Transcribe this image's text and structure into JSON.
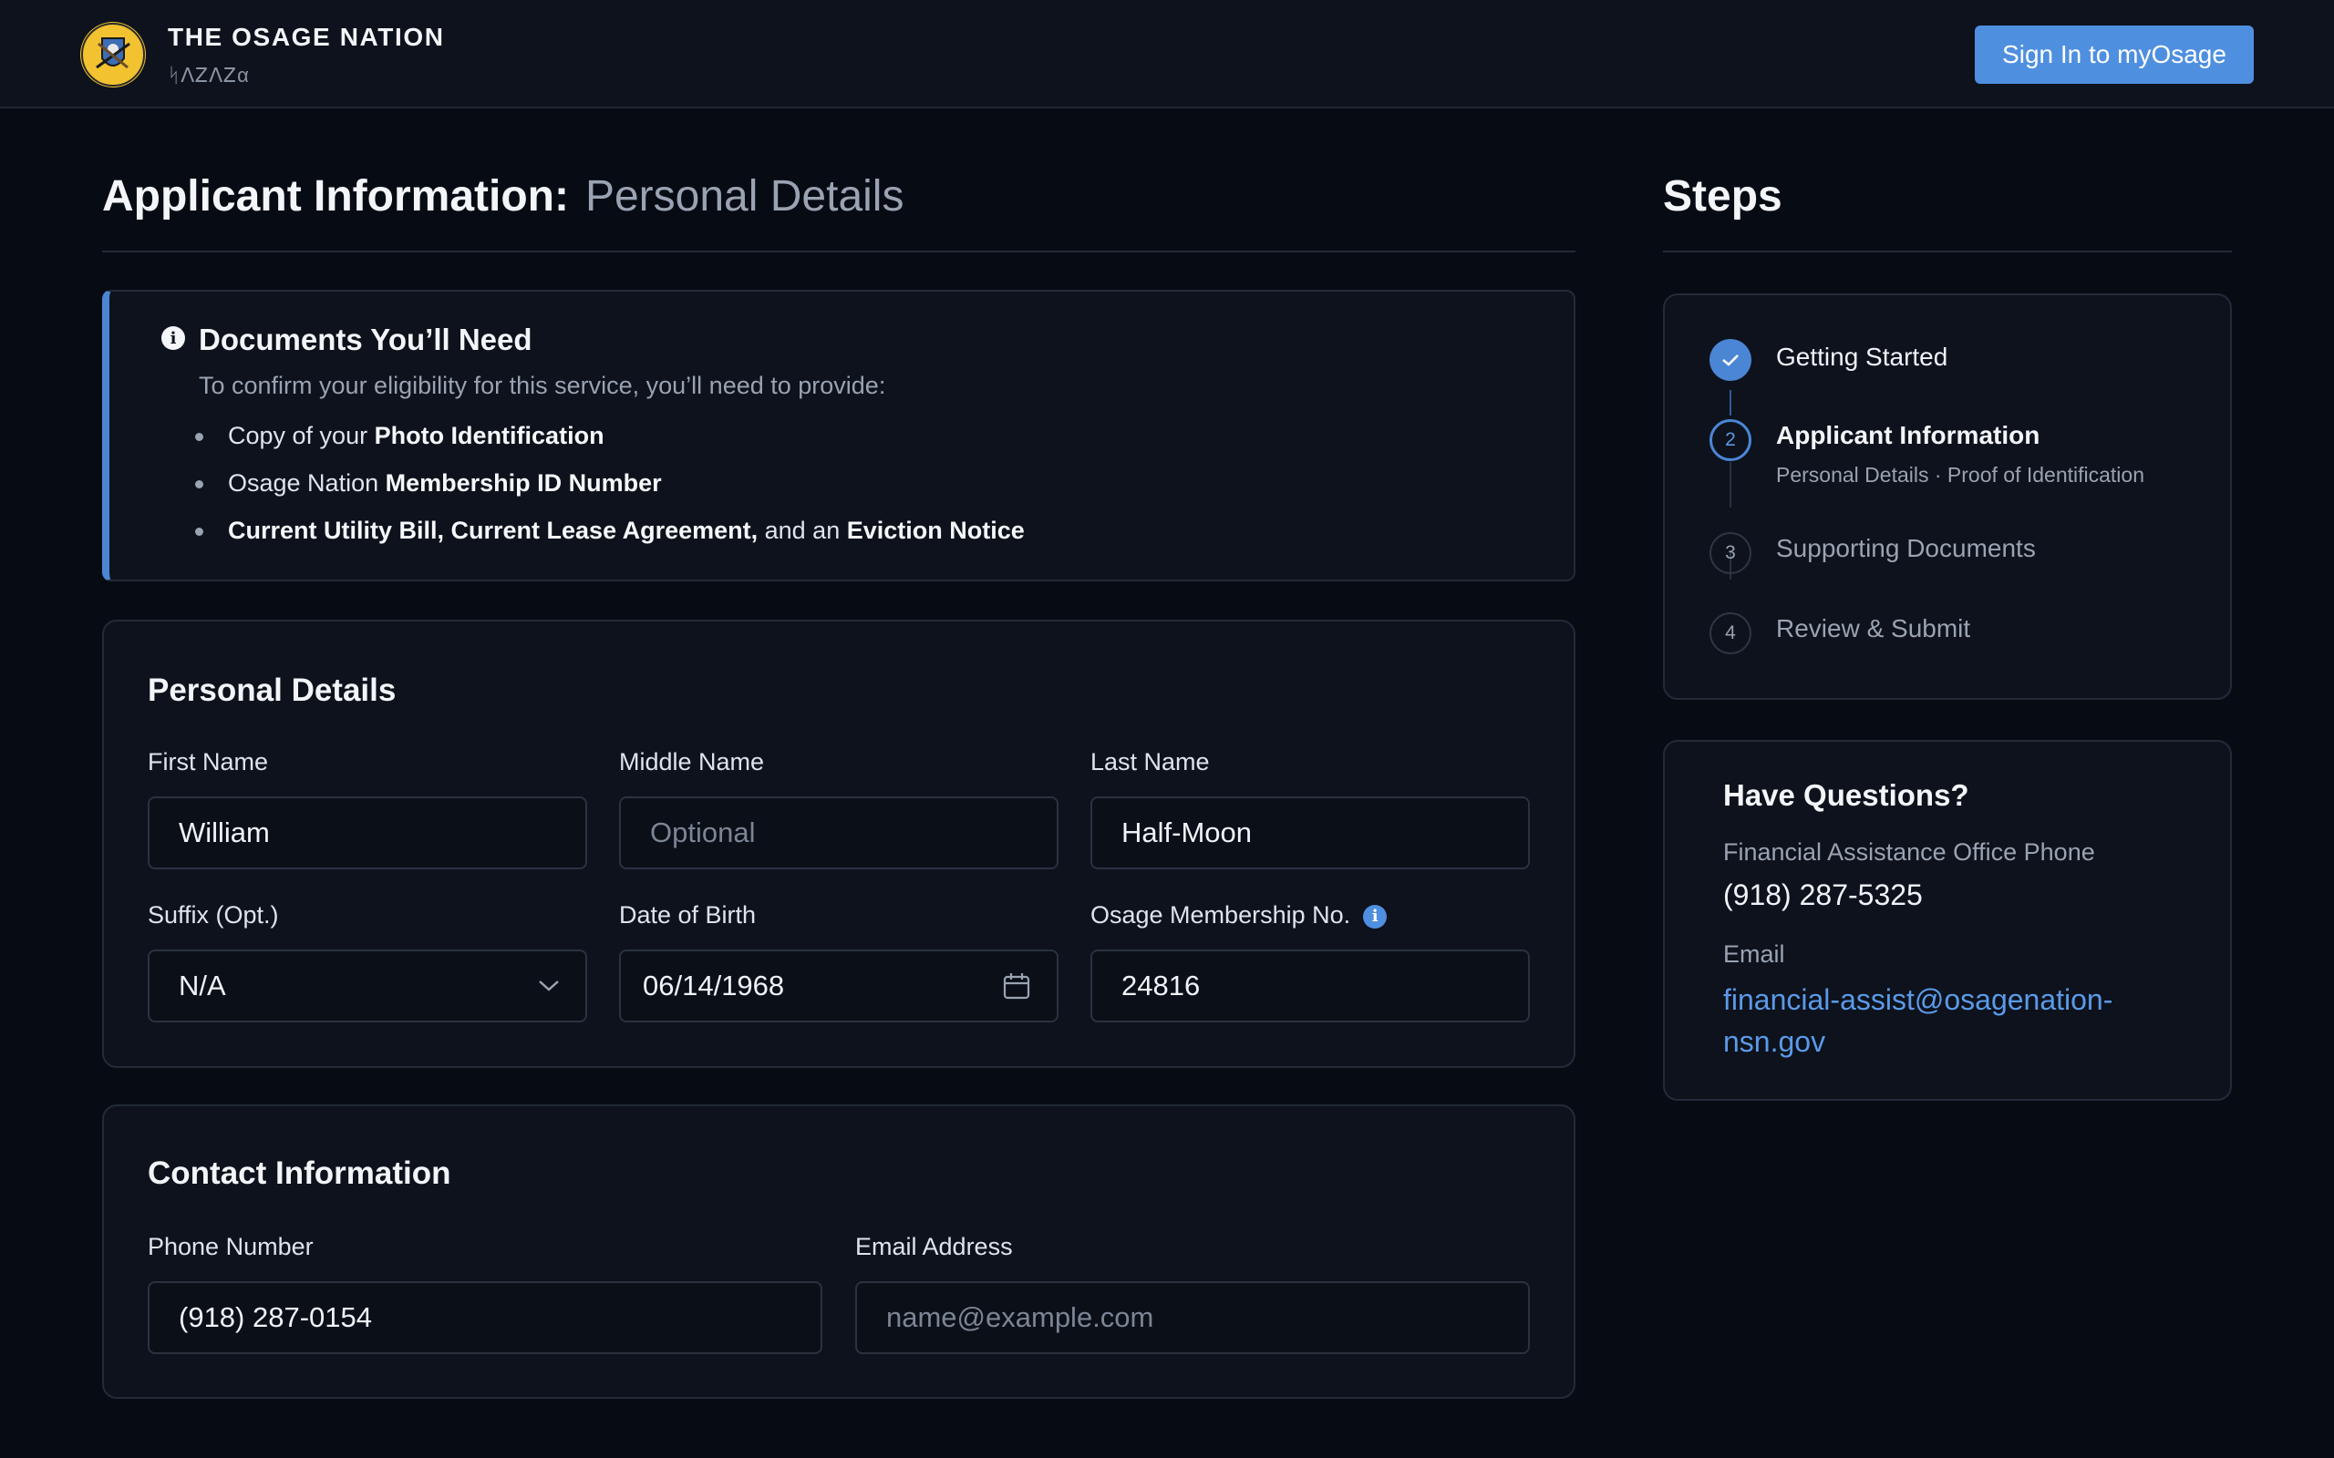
{
  "header": {
    "org_name": "THE OSAGE NATION",
    "org_name_native": "ᛋᐱᏃᐱᏃα",
    "signin_label": "Sign In to myOsage"
  },
  "page": {
    "title": "Applicant Information:",
    "subtitle": "Personal Details"
  },
  "documents": {
    "title": "Documents You’ll Need",
    "description": "To confirm your eligibility for this service, you’ll need to provide:",
    "items": [
      {
        "prefix": "Copy of your ",
        "bold": "Photo Identification",
        "suffix": ""
      },
      {
        "prefix": "Osage Nation ",
        "bold": "Membership ID Number",
        "suffix": ""
      },
      {
        "prefix": "",
        "bold": "Current Utility Bill, Current Lease Agreement,",
        "middle": " and an ",
        "bold2": "Eviction Notice"
      }
    ]
  },
  "personal": {
    "title": "Personal Details",
    "first_name": {
      "label": "First Name",
      "value": "William"
    },
    "middle_name": {
      "label": "Middle Name",
      "placeholder": "Optional"
    },
    "last_name": {
      "label": "Last Name",
      "value": "Half-Moon"
    },
    "suffix": {
      "label": "Suffix (Opt.)",
      "value": "N/A"
    },
    "dob": {
      "label": "Date of Birth",
      "value": "06/14/1968"
    },
    "membership": {
      "label": "Osage Membership No.",
      "value": "24816"
    }
  },
  "contact": {
    "title": "Contact Information",
    "phone": {
      "label": "Phone Number",
      "value": "(918) 287-0154"
    },
    "email": {
      "label": "Email Address",
      "placeholder": "name@example.com"
    }
  },
  "steps": {
    "title": "Steps",
    "items": [
      {
        "label": "Getting Started",
        "status": "complete"
      },
      {
        "number": "2",
        "label": "Applicant Information",
        "sub": "Personal Details · Proof of Identification",
        "status": "current"
      },
      {
        "number": "3",
        "label": "Supporting Documents",
        "status": "upcoming"
      },
      {
        "number": "4",
        "label": "Review & Submit",
        "status": "upcoming"
      }
    ]
  },
  "questions": {
    "title": "Have Questions?",
    "phone_label": "Financial Assistance Office Phone",
    "phone": "(918) 287-5325",
    "email_label": "Email",
    "email": "financial-assist@osagenation-nsn.gov"
  },
  "colors": {
    "accent": "#4f8fe0",
    "background": "#070b14",
    "card": "#0d121c",
    "seal": "#f2c230"
  },
  "icons": [
    "osage-seal-logo",
    "info-icon",
    "chevron-down-icon",
    "calendar-icon",
    "help-icon",
    "check-icon"
  ]
}
